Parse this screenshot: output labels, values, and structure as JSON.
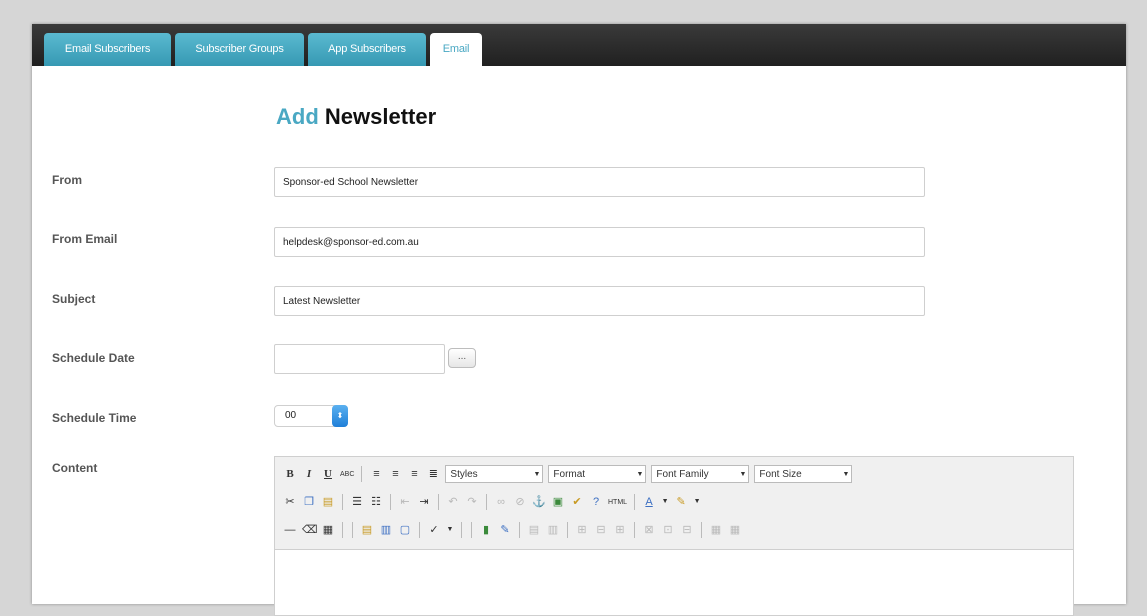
{
  "tabs": [
    {
      "label": "Email Subscribers",
      "active": false
    },
    {
      "label": "Subscriber Groups",
      "active": false
    },
    {
      "label": "App Subscribers",
      "active": false
    },
    {
      "label": "Email",
      "active": true
    }
  ],
  "heading": {
    "accent": "Add",
    "rest": "Newsletter"
  },
  "form": {
    "from": {
      "label": "From",
      "value": "Sponsor-ed School Newsletter"
    },
    "from_email": {
      "label": "From Email",
      "value": "helpdesk@sponsor-ed.com.au"
    },
    "subject": {
      "label": "Subject",
      "value": "Latest Newsletter"
    },
    "schedule_date": {
      "label": "Schedule Date",
      "value": "",
      "button": "..."
    },
    "schedule_time": {
      "label": "Schedule Time",
      "value": "00"
    },
    "content": {
      "label": "Content"
    }
  },
  "editor": {
    "styles": "Styles",
    "format": "Format",
    "font_family": "Font Family",
    "font_size": "Font Size",
    "bold": "B",
    "italic": "I",
    "underline": "U",
    "strike": "ABC",
    "html": "HTML",
    "font_color": "A"
  },
  "colors": {
    "accent": "#4aa8c3",
    "tab_bg": "#3699b3",
    "tabbar": "#262626"
  }
}
